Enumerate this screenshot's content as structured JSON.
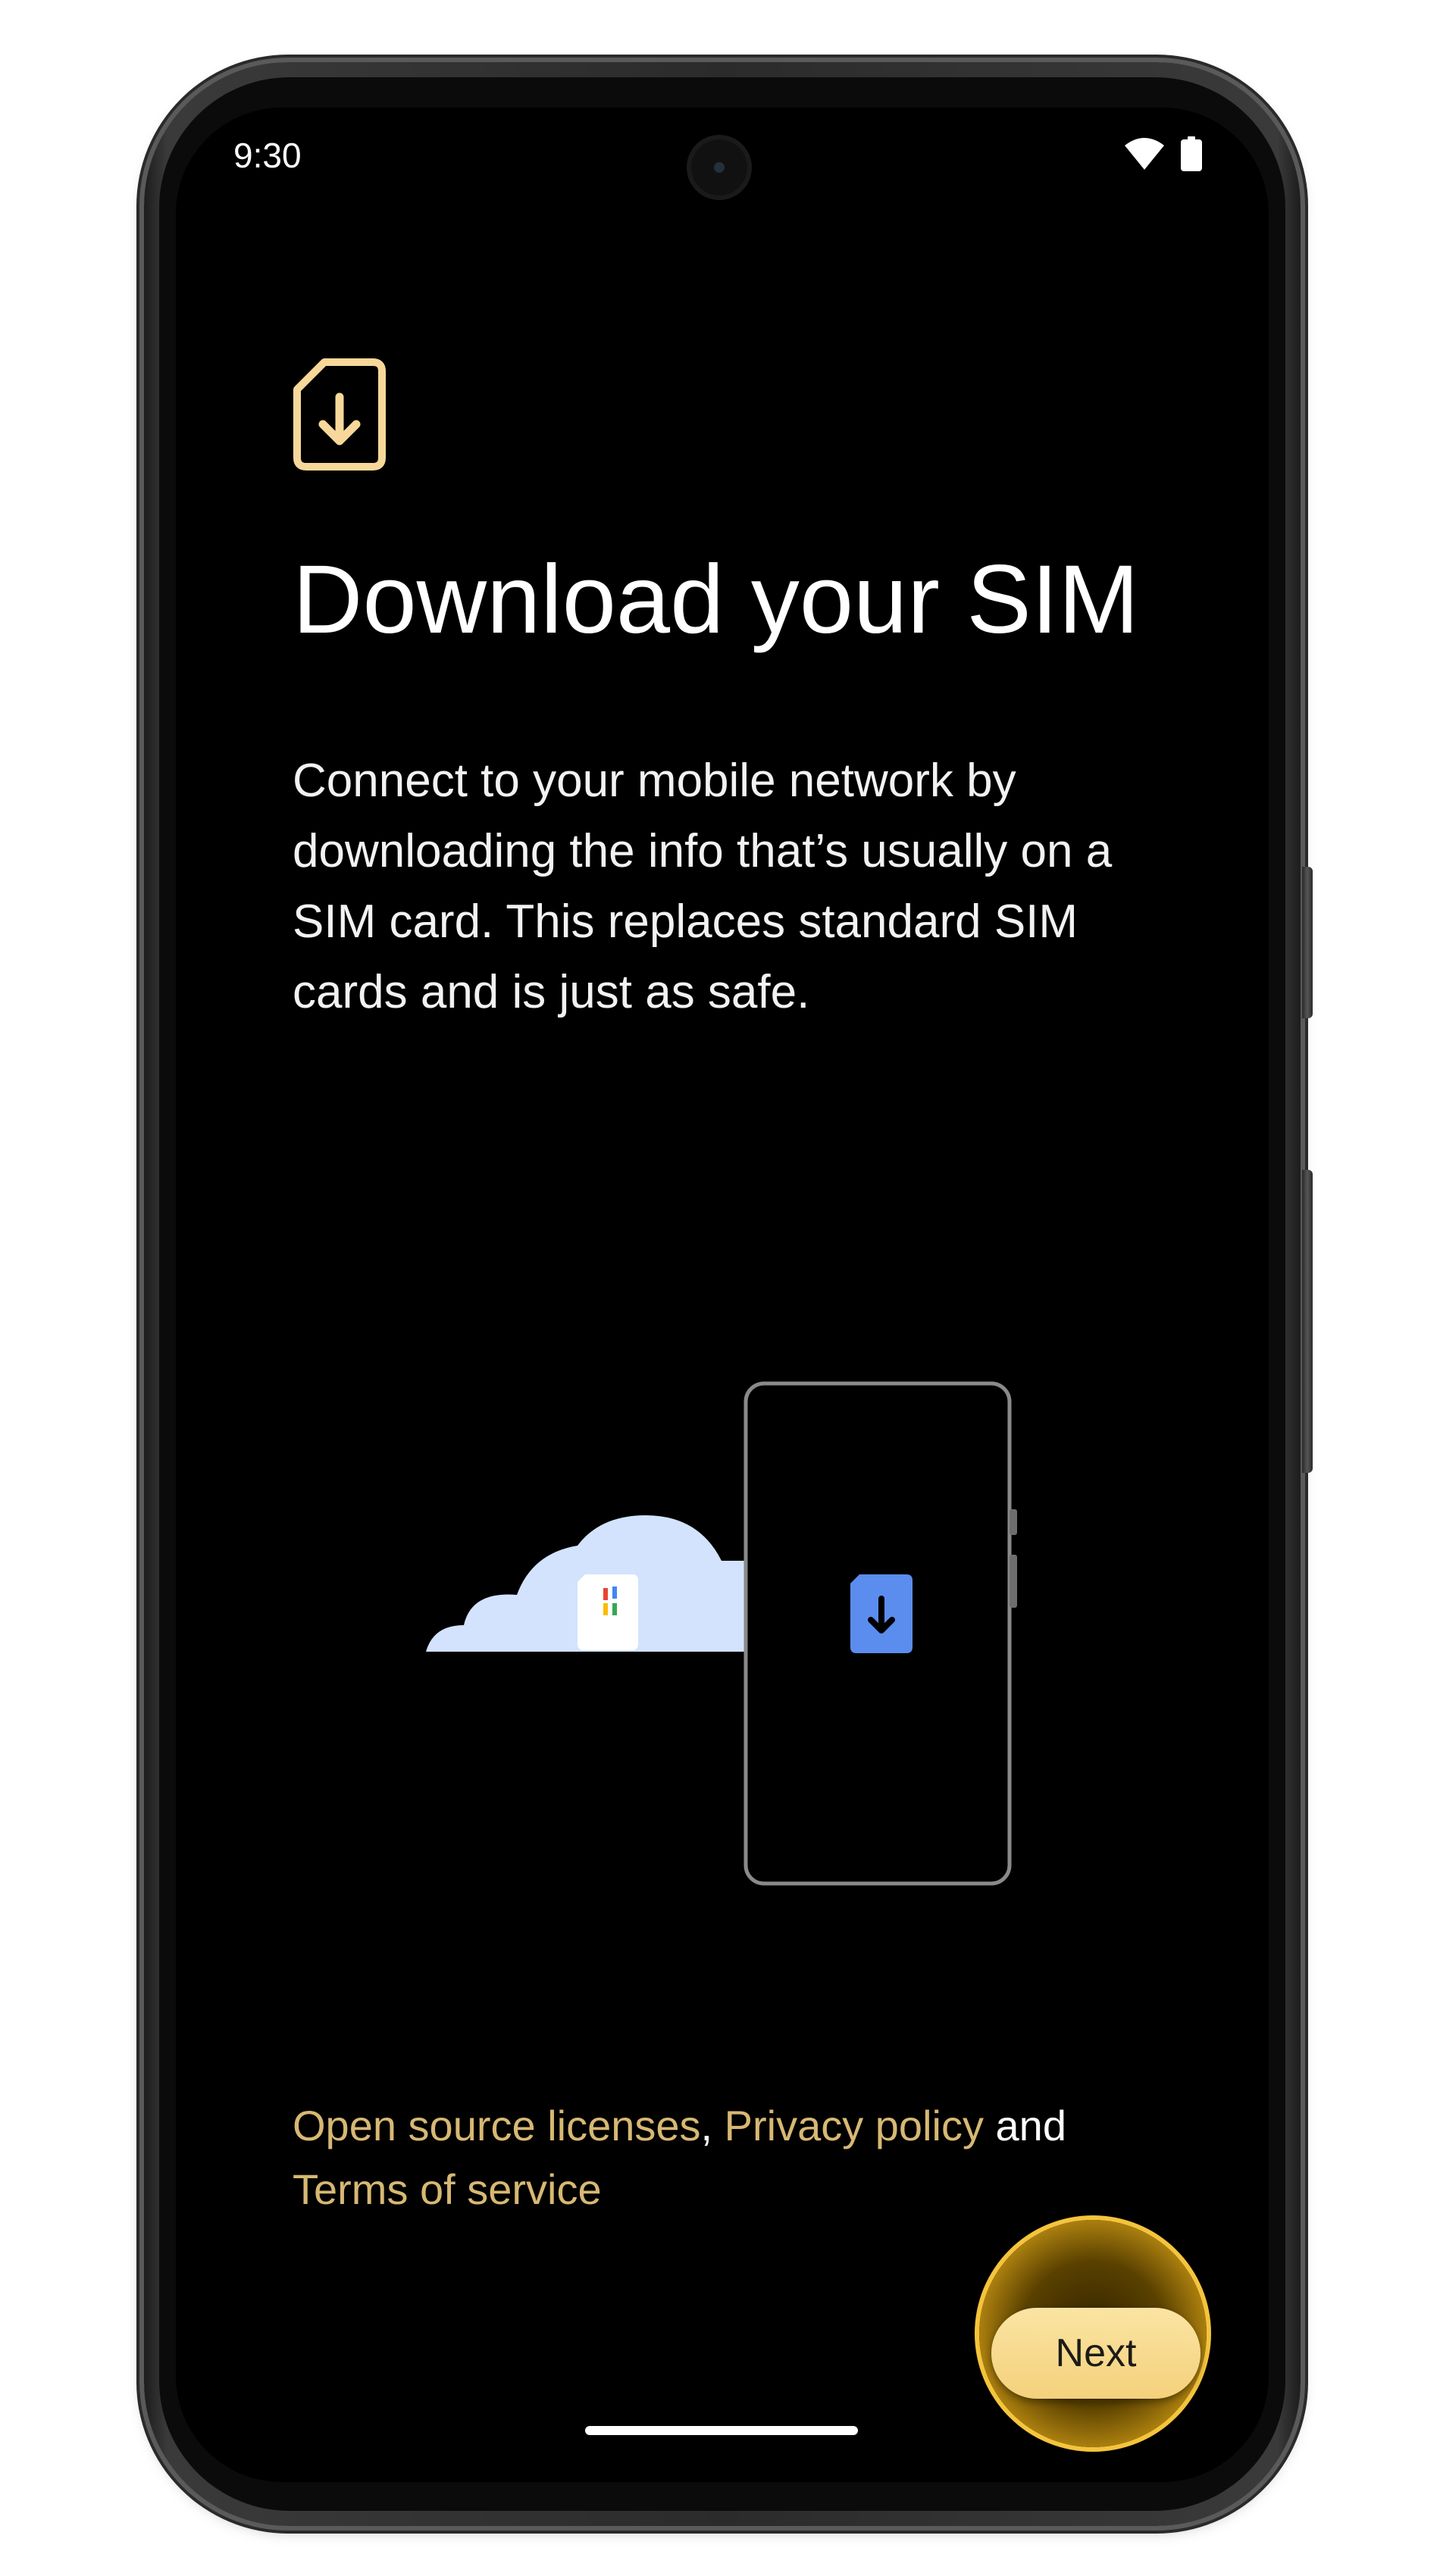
{
  "status_bar": {
    "time": "9:30",
    "icons": [
      "wifi-icon",
      "battery-icon"
    ]
  },
  "page": {
    "header_icon": "sim-download-icon",
    "title": "Download your SIM",
    "description": "Connect to your mobile network by downloading the info that’s usually on a SIM card. This replaces standard SIM cards and is just as safe."
  },
  "illustration": {
    "icons": [
      "cloud-icon",
      "sim-card-icon",
      "phone-outline-icon",
      "esim-download-icon"
    ],
    "colors": {
      "cloud": "#d3e3fd",
      "phone_outline": "#8a8a8a",
      "esim": "#5b8def"
    }
  },
  "legal": {
    "open_source": "Open source licenses",
    "comma": ",",
    "privacy": "Privacy policy",
    "and": "and",
    "terms": "Terms of service"
  },
  "actions": {
    "next_label": "Next"
  },
  "colors": {
    "background": "#000000",
    "accent": "#d7b873",
    "button": "#f4d17c",
    "highlight_ring": "#f5c43c"
  }
}
